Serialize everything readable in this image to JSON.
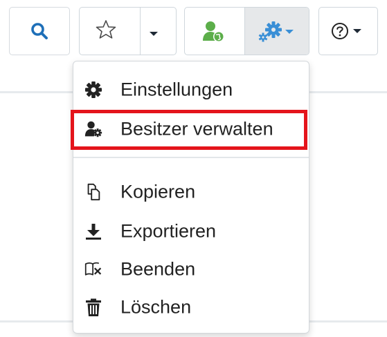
{
  "toolbar": {
    "search_icon": "search-icon",
    "favorite_icon": "star-outline-icon",
    "favorite_dropdown_icon": "caret-down-icon",
    "owner_icon": "user-globe-icon",
    "tools_icon": "gears-icon",
    "help_icon": "question-circle-icon",
    "colors": {
      "search": "#1e6fb8",
      "owner": "#5cae4a",
      "tools": "#3a8fd6"
    }
  },
  "menu": {
    "items": [
      {
        "label": "Einstellungen",
        "icon": "cog-icon"
      },
      {
        "label": "Besitzer verwalten",
        "icon": "user-cog-icon",
        "highlighted": true
      },
      {
        "label": "Kopieren",
        "icon": "copy-icon"
      },
      {
        "label": "Exportieren",
        "icon": "download-icon"
      },
      {
        "label": "Beenden",
        "icon": "book-close-icon"
      },
      {
        "label": "Löschen",
        "icon": "trash-icon"
      }
    ],
    "highlight_color": "#e4141b"
  }
}
